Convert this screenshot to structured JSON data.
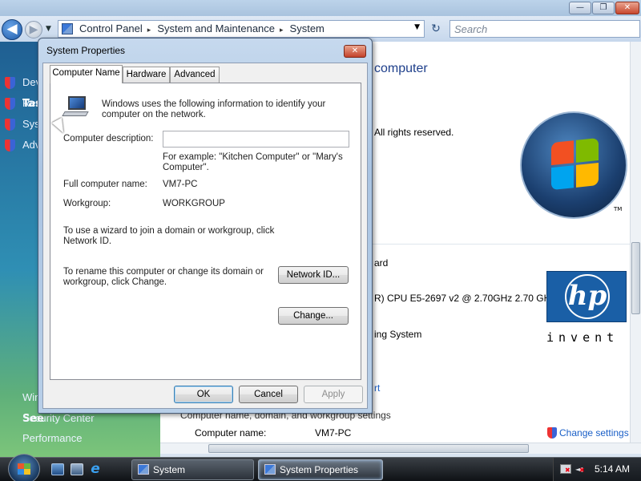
{
  "window": {
    "minimize_glyph": "—",
    "maximize_glyph": "❐",
    "close_glyph": "✕"
  },
  "nav": {
    "back_glyph": "◀",
    "forward_glyph": "▶",
    "dropdown_glyph": "▼",
    "refresh_glyph": "↻",
    "breadcrumbs": [
      "Control Panel",
      "System and Maintenance",
      "System"
    ],
    "breadcrumb_sep": "▸",
    "search_placeholder": "Search"
  },
  "left_pane": {
    "tasks_heading": "Tas",
    "tasks": [
      "Dev",
      "Rer",
      "Syst",
      "Adv"
    ],
    "see_also_heading": "See",
    "see_also": [
      "Win",
      "Security Center",
      "Performance"
    ]
  },
  "content": {
    "title_fragment": "computer",
    "rights_text": "All rights reserved.",
    "rating_fragment": "ard",
    "processor_fragment": "R) CPU E5-2697 v2 @ 2.70GHz   2.70 GHz",
    "os_type_fragment": "ing System",
    "support_fragment": "rt",
    "group_header": "Computer name, domain, and workgroup settings",
    "computer_name_label": "Computer name:",
    "computer_name_value": "VM7-PC",
    "change_settings_link": "Change settings",
    "tm": "TM",
    "hp_logo": "hp",
    "hp_tagline": "invent"
  },
  "dialog": {
    "title": "System Properties",
    "close_glyph": "✕",
    "tabs": [
      "Computer Name",
      "Hardware",
      "Advanced"
    ],
    "intro_text": "Windows uses the following information to identify your computer on the network.",
    "description_label": "Computer description:",
    "description_value": "",
    "example_text": "For example: \"Kitchen Computer\" or \"Mary's Computer\".",
    "full_name_label": "Full computer name:",
    "full_name_value": "VM7-PC",
    "workgroup_label": "Workgroup:",
    "workgroup_value": "WORKGROUP",
    "wizard_text": "To use a wizard to join a domain or workgroup, click Network ID.",
    "network_id_button": "Network ID...",
    "rename_text": "To rename this computer or change its domain or workgroup, click Change.",
    "change_button": "Change...",
    "ok_button": "OK",
    "cancel_button": "Cancel",
    "apply_button": "Apply"
  },
  "taskbar": {
    "items": [
      "System",
      "System Properties"
    ],
    "clock": "5:14 AM",
    "vol_glyph": "◄"
  }
}
